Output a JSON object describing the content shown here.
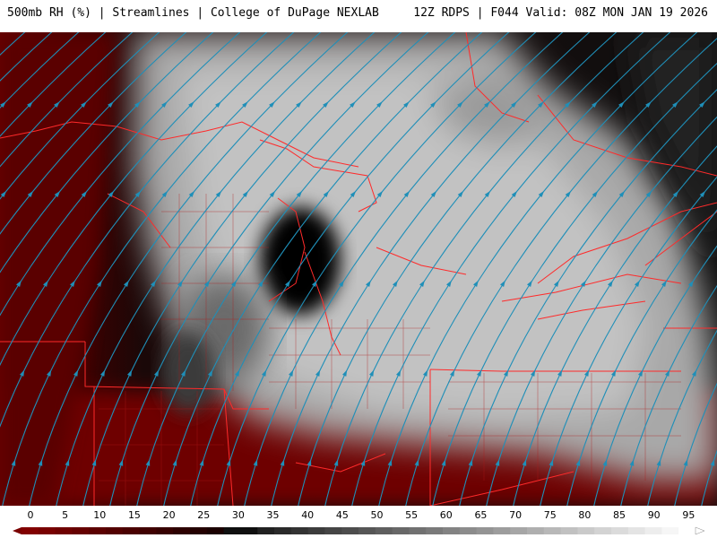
{
  "header": {
    "left": "500mb RH (%) | Streamlines | College of DuPage NEXLAB",
    "right": "12Z RDPS | F044 Valid: 08Z MON JAN 19 2026"
  },
  "legend": {
    "labels": [
      "0",
      "5",
      "10",
      "15",
      "20",
      "25",
      "30",
      "35",
      "40",
      "45",
      "50",
      "55",
      "60",
      "65",
      "70",
      "75",
      "80",
      "85",
      "90",
      "95"
    ]
  },
  "colors": {
    "streamline": "#1f8fb8",
    "border": "#ff2a2a",
    "low_rh": "#7a0000",
    "high_rh": "#f2f2f2"
  }
}
